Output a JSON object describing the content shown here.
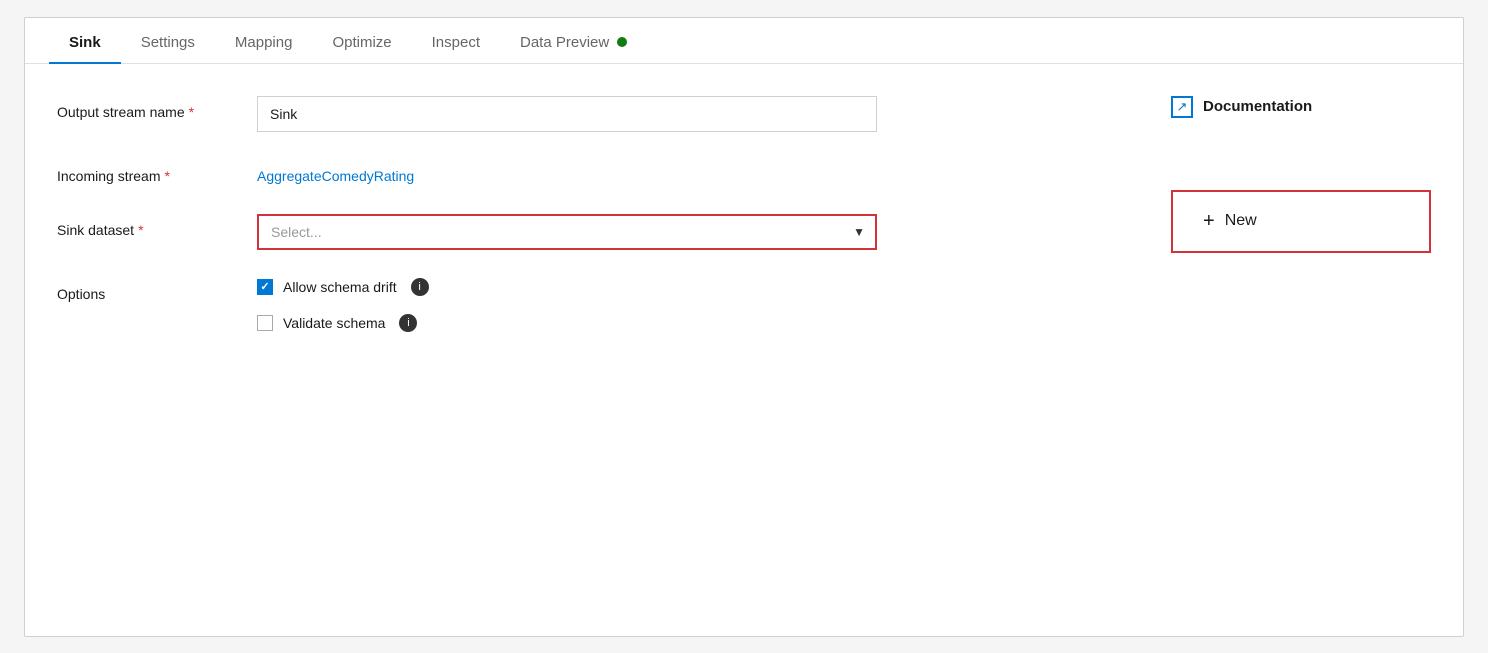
{
  "tabs": [
    {
      "id": "sink",
      "label": "Sink",
      "active": true
    },
    {
      "id": "settings",
      "label": "Settings",
      "active": false
    },
    {
      "id": "mapping",
      "label": "Mapping",
      "active": false
    },
    {
      "id": "optimize",
      "label": "Optimize",
      "active": false
    },
    {
      "id": "inspect",
      "label": "Inspect",
      "active": false
    },
    {
      "id": "data-preview",
      "label": "Data Preview",
      "active": false
    }
  ],
  "form": {
    "output_stream_label": "Output stream name",
    "output_stream_required": "*",
    "output_stream_value": "Sink",
    "output_stream_placeholder": "Sink",
    "incoming_stream_label": "Incoming stream",
    "incoming_stream_required": "*",
    "incoming_stream_value": "AggregateComedyRating",
    "sink_dataset_label": "Sink dataset",
    "sink_dataset_required": "*",
    "sink_dataset_placeholder": "Select...",
    "options_label": "Options",
    "allow_schema_drift_label": "Allow schema drift",
    "allow_schema_drift_checked": true,
    "validate_schema_label": "Validate schema",
    "validate_schema_checked": false
  },
  "documentation": {
    "label": "Documentation"
  },
  "new_button": {
    "label": "New",
    "plus": "+"
  },
  "status_dot_color": "#107c10"
}
